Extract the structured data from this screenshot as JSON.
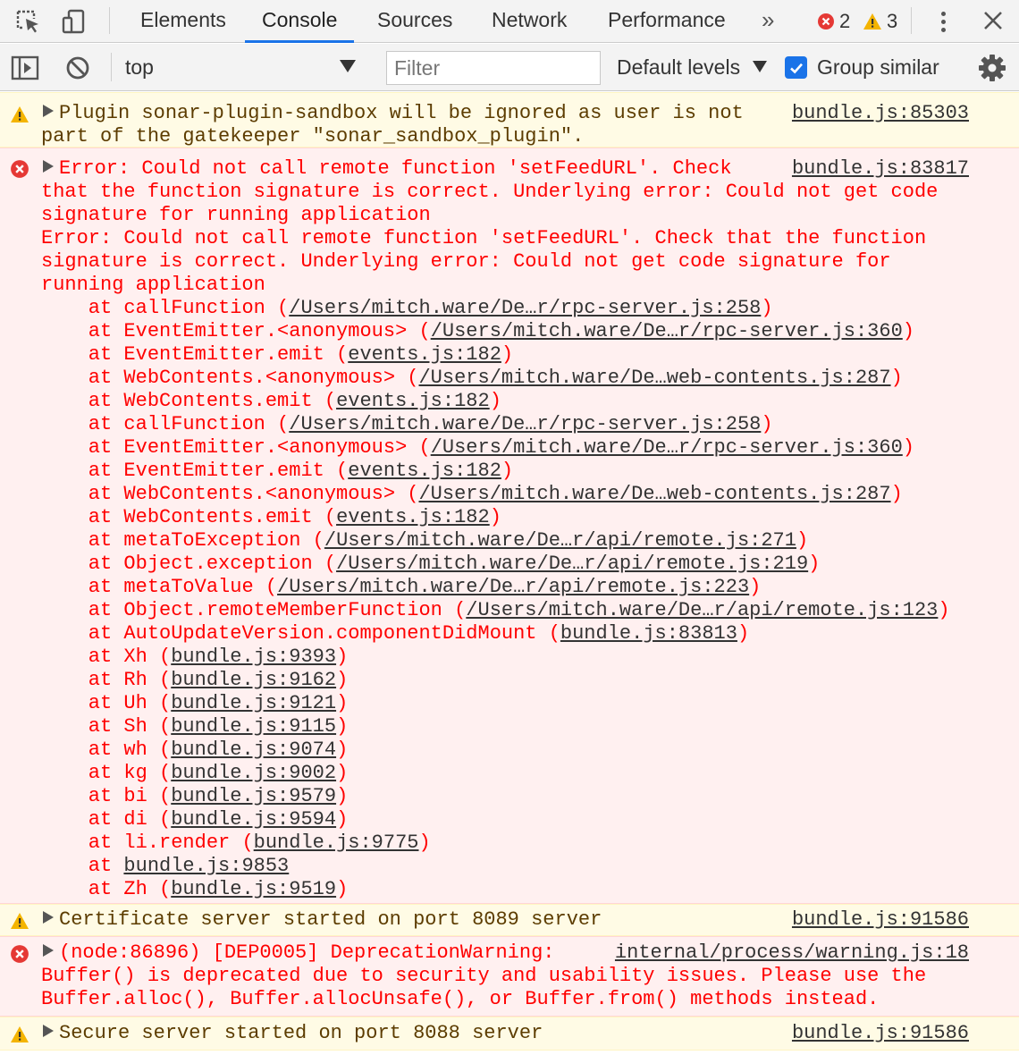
{
  "tabs": [
    {
      "label": "Elements"
    },
    {
      "label": "Console"
    },
    {
      "label": "Sources"
    },
    {
      "label": "Network"
    },
    {
      "label": "Performance"
    }
  ],
  "counts": {
    "errors": "2",
    "warnings": "3"
  },
  "toolbar": {
    "context": "top",
    "filter_placeholder": "Filter",
    "levels": "Default levels",
    "group_similar": "Group similar",
    "group_similar_checked": true
  },
  "colors": {
    "accent": "#1a73e8",
    "error": "#ff0000",
    "warning_bg": "#fffbe5",
    "error_bg": "#fff0f0"
  },
  "messages": [
    {
      "level": "warning",
      "lines": [
        "Plugin sonar-plugin-sandbox will be ignored as user is not",
        "part of the gatekeeper \"sonar_sandbox_plugin\"."
      ],
      "source": "bundle.js:85303"
    },
    {
      "level": "error",
      "lines": [
        "Error: Could not call remote function 'setFeedURL'. Check",
        "that the function signature is correct. Underlying error: Could not get code",
        "signature for running application",
        "Error: Could not call remote function 'setFeedURL'. Check that the function",
        "signature is correct. Underlying error: Could not get code signature for",
        "running application"
      ],
      "source": "bundle.js:83817",
      "stack": [
        {
          "fn": "callFunction",
          "loc": "/Users/mitch.ware/De…r/rpc-server.js:258"
        },
        {
          "fn": "EventEmitter.<anonymous>",
          "loc": "/Users/mitch.ware/De…r/rpc-server.js:360"
        },
        {
          "fn": "EventEmitter.emit",
          "loc": "events.js:182"
        },
        {
          "fn": "WebContents.<anonymous>",
          "loc": "/Users/mitch.ware/De…web-contents.js:287"
        },
        {
          "fn": "WebContents.emit",
          "loc": "events.js:182"
        },
        {
          "fn": "callFunction",
          "loc": "/Users/mitch.ware/De…r/rpc-server.js:258"
        },
        {
          "fn": "EventEmitter.<anonymous>",
          "loc": "/Users/mitch.ware/De…r/rpc-server.js:360"
        },
        {
          "fn": "EventEmitter.emit",
          "loc": "events.js:182"
        },
        {
          "fn": "WebContents.<anonymous>",
          "loc": "/Users/mitch.ware/De…web-contents.js:287"
        },
        {
          "fn": "WebContents.emit",
          "loc": "events.js:182"
        },
        {
          "fn": "metaToException",
          "loc": "/Users/mitch.ware/De…r/api/remote.js:271"
        },
        {
          "fn": "Object.exception",
          "loc": "/Users/mitch.ware/De…r/api/remote.js:219"
        },
        {
          "fn": "metaToValue",
          "loc": "/Users/mitch.ware/De…r/api/remote.js:223"
        },
        {
          "fn": "Object.remoteMemberFunction",
          "loc": "/Users/mitch.ware/De…r/api/remote.js:123"
        },
        {
          "fn": "AutoUpdateVersion.componentDidMount",
          "loc": "bundle.js:83813"
        },
        {
          "fn": "Xh",
          "loc": "bundle.js:9393"
        },
        {
          "fn": "Rh",
          "loc": "bundle.js:9162"
        },
        {
          "fn": "Uh",
          "loc": "bundle.js:9121"
        },
        {
          "fn": "Sh",
          "loc": "bundle.js:9115"
        },
        {
          "fn": "wh",
          "loc": "bundle.js:9074"
        },
        {
          "fn": "kg",
          "loc": "bundle.js:9002"
        },
        {
          "fn": "bi",
          "loc": "bundle.js:9579"
        },
        {
          "fn": "di",
          "loc": "bundle.js:9594"
        },
        {
          "fn": "li.render",
          "loc": "bundle.js:9775"
        },
        {
          "fn": "",
          "loc": "bundle.js:9853"
        },
        {
          "fn": "Zh",
          "loc": "bundle.js:9519"
        }
      ]
    },
    {
      "level": "warning",
      "lines": [
        "Certificate server started on port 8089 server"
      ],
      "source": "bundle.js:91586"
    },
    {
      "level": "error",
      "lines": [
        "(node:86896) [DEP0005] DeprecationWarning:",
        "Buffer() is deprecated due to security and usability issues. Please use the",
        "Buffer.alloc(), Buffer.allocUnsafe(), or Buffer.from() methods instead."
      ],
      "source": "internal/process/warning.js:18"
    },
    {
      "level": "warning",
      "lines": [
        "Secure server started on port 8088 server"
      ],
      "source": "bundle.js:91586"
    }
  ]
}
